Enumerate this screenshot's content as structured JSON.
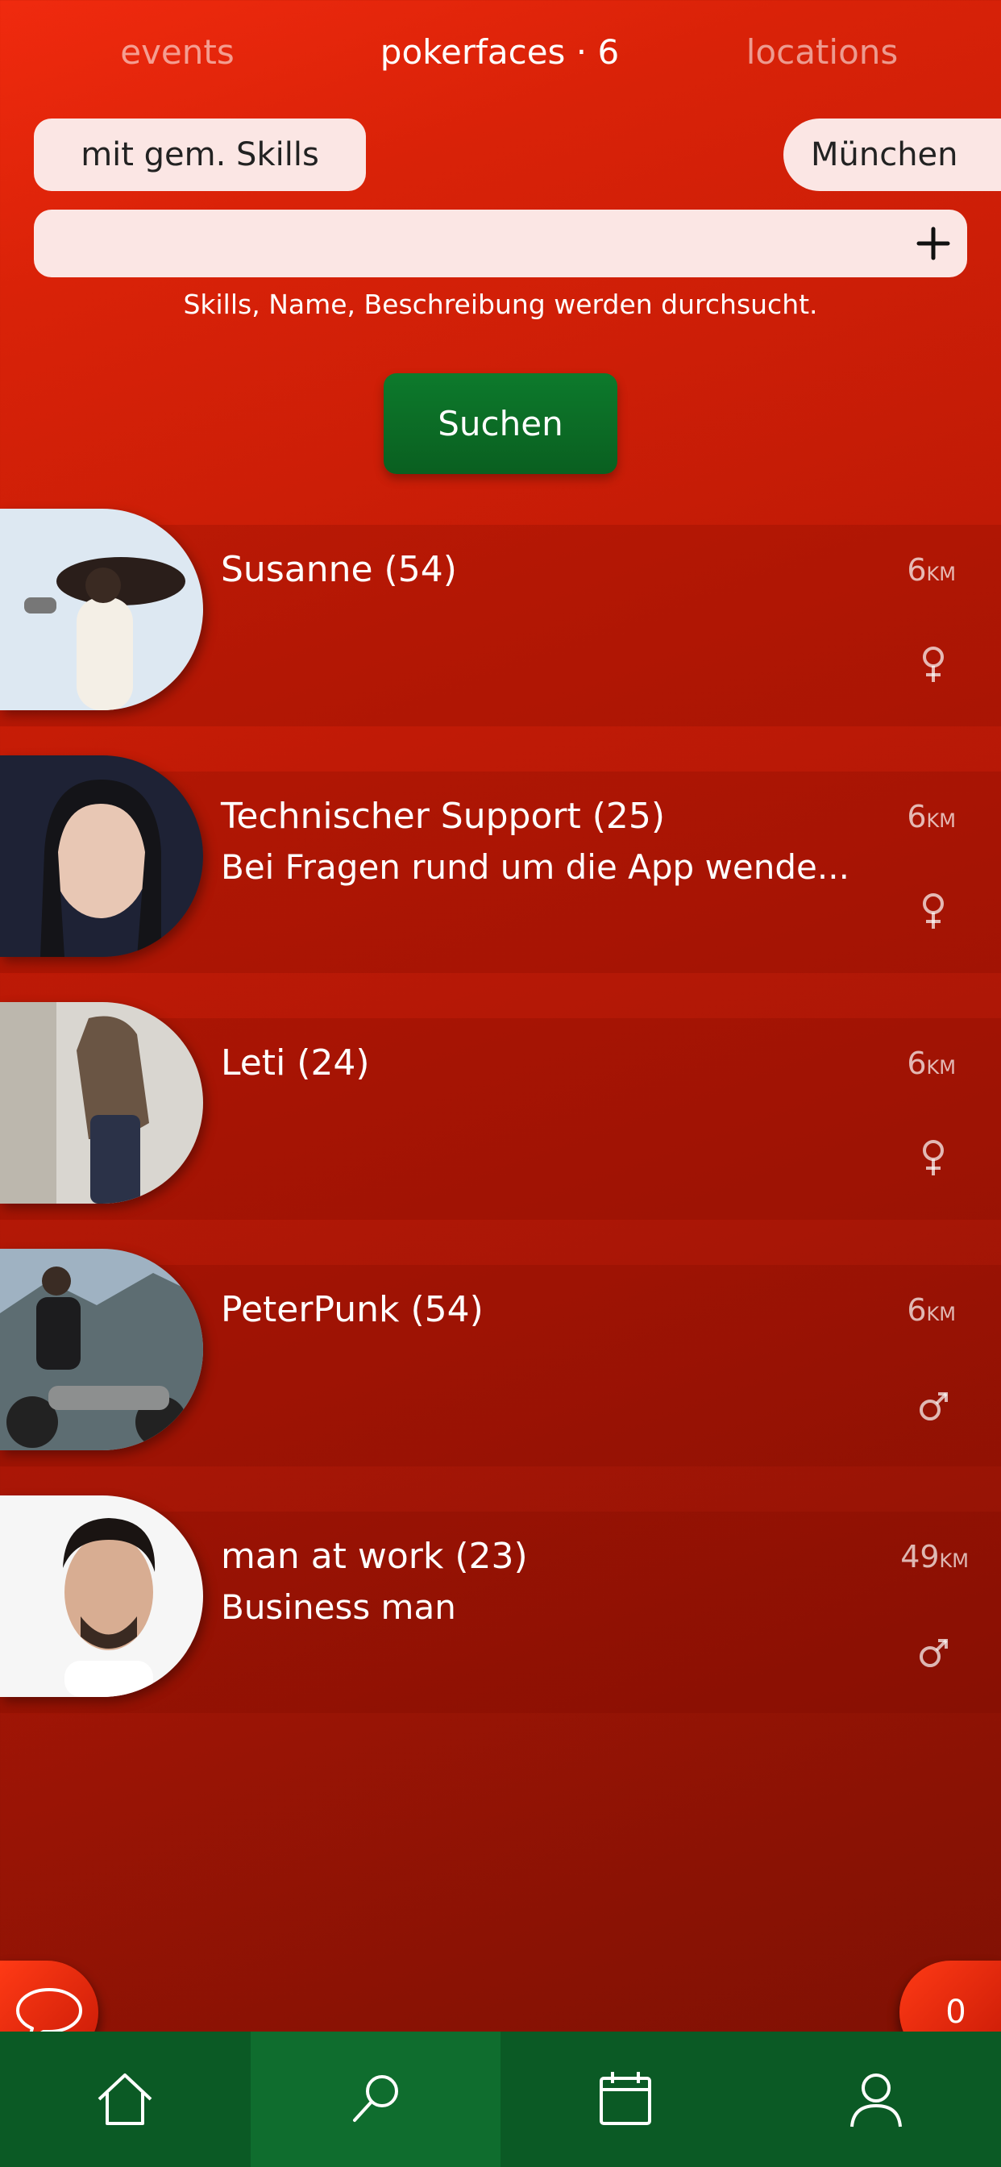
{
  "tabs": {
    "events": "events",
    "pokerfaces": "pokerfaces · 6",
    "locations": "locations"
  },
  "filters": {
    "skills": "mit gem. Skills",
    "city": "München"
  },
  "search": {
    "value": "",
    "placeholder": "",
    "hint": "Skills, Name, Beschreibung werden durchsucht.",
    "button": "Suchen"
  },
  "results": [
    {
      "name": "Susanne (54)",
      "description": "",
      "distance": "6",
      "unit": "KM",
      "gender": "female"
    },
    {
      "name": "Technischer Support (25)",
      "description": "Bei Fragen rund um die App wende...",
      "distance": "6",
      "unit": "KM",
      "gender": "female"
    },
    {
      "name": "Leti (24)",
      "description": "",
      "distance": "6",
      "unit": "KM",
      "gender": "female"
    },
    {
      "name": "PeterPunk (54)",
      "description": "",
      "distance": "6",
      "unit": "KM",
      "gender": "male"
    },
    {
      "name": "man at work (23)",
      "description": "Business man",
      "distance": "49",
      "unit": "KM",
      "gender": "male"
    }
  ],
  "fab": {
    "counter": "0"
  },
  "nav": [
    "home-icon",
    "search-icon",
    "calendar-icon",
    "profile-icon"
  ],
  "colors": {
    "accent_red": "#d92208",
    "nav_green": "#0b5a25",
    "button_green": "#0a6a26"
  }
}
